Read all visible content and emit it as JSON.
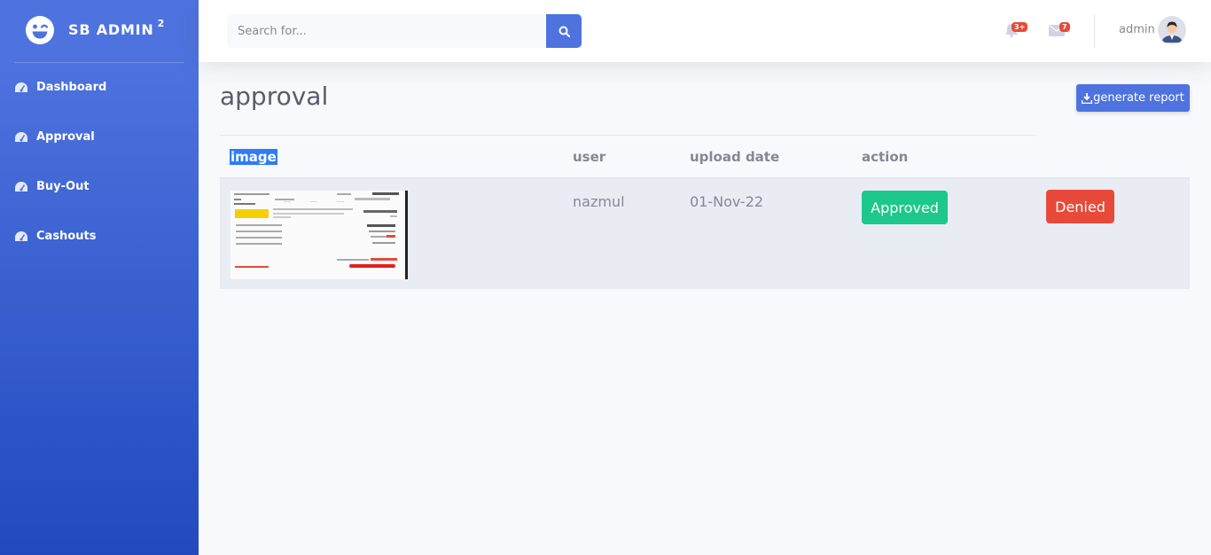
{
  "brand": {
    "title": "SB ADMIN",
    "superscript": "2"
  },
  "sidebar": {
    "items": [
      {
        "label": "Dashboard",
        "icon": "tachometer-icon"
      },
      {
        "label": "Approval",
        "icon": "tachometer-icon"
      },
      {
        "label": "Buy-Out",
        "icon": "tachometer-icon"
      },
      {
        "label": "Cashouts",
        "icon": "tachometer-icon"
      }
    ]
  },
  "topbar": {
    "search_placeholder": "Search for...",
    "alerts_badge": "3+",
    "messages_badge": "7",
    "user_name": "admin"
  },
  "page": {
    "title": "approval",
    "report_button": "generate report"
  },
  "table": {
    "headers": [
      "image",
      "user",
      "upload date",
      "action"
    ],
    "rows": [
      {
        "user": "nazmul",
        "upload_date": "01-Nov-22",
        "approve_label": "Approved",
        "deny_label": "Denied"
      }
    ]
  },
  "colors": {
    "primary": "#4e73df",
    "success": "#1cc88a",
    "danger": "#e74a3b",
    "selection": "#2e7cf6"
  }
}
